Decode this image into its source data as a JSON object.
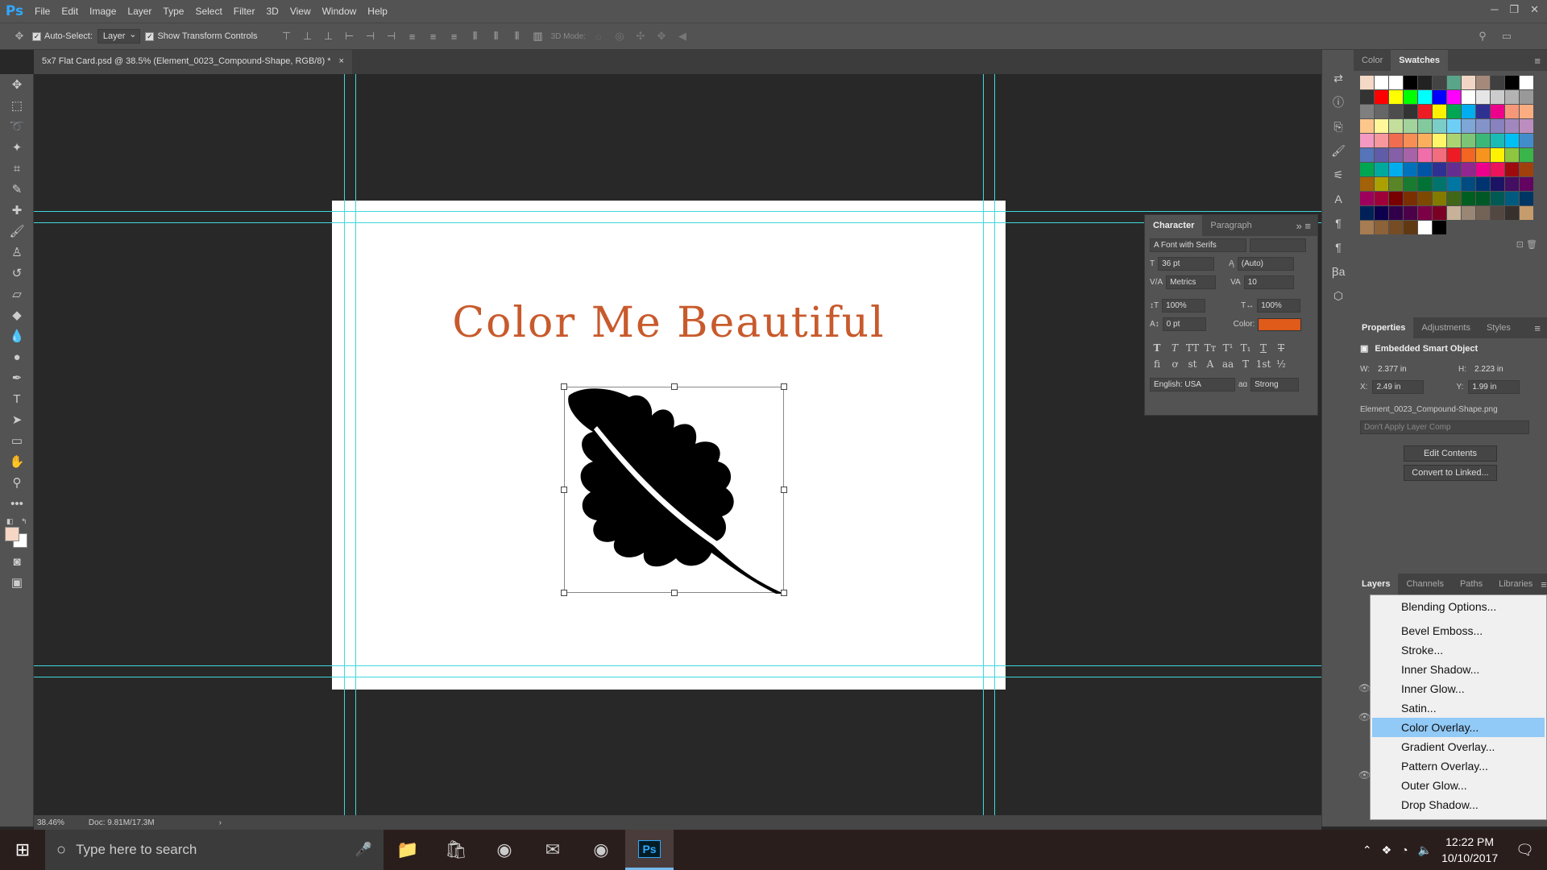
{
  "app": {
    "logo": "Ps"
  },
  "menubar": [
    "File",
    "Edit",
    "Image",
    "Layer",
    "Type",
    "Select",
    "Filter",
    "3D",
    "View",
    "Window",
    "Help"
  ],
  "options": {
    "auto_select_label": "Auto-Select:",
    "auto_select_value": "Layer",
    "show_transform_label": "Show Transform Controls",
    "mode3d_label": "3D Mode:"
  },
  "document": {
    "tab_title": "5x7 Flat Card.psd @ 38.5% (Element_0023_Compound-Shape, RGB/8) *",
    "close_glyph": "×"
  },
  "card": {
    "title": "Color Me Beautiful",
    "title_color": "#c85a2c"
  },
  "status": {
    "zoom": "38.46%",
    "doc": "Doc: 9.81M/17.3M",
    "arrow": "›"
  },
  "color_panel": {
    "tabs": [
      "Color",
      "Swatches"
    ],
    "active": "Swatches"
  },
  "swatch_colors": [
    "#f4d9c7",
    "#fff",
    "#fff",
    "#000",
    "#222",
    "#444",
    "#59a58a",
    "#f2d6c5",
    "#a58a7c",
    "#3f3f3f",
    "#000",
    "#fff",
    "#333",
    "#ff0000",
    "#ffff00",
    "#00ff00",
    "#00ffff",
    "#0000ff",
    "#ff00ff",
    "#fff",
    "#e6e6e6",
    "#cccccc",
    "#b3b3b3",
    "#999999",
    "#7f7f7f",
    "#666",
    "#4d4d4d",
    "#333",
    "#ed1c24",
    "#fff200",
    "#00a651",
    "#00aeef",
    "#2e3192",
    "#ec008c",
    "#f7977a",
    "#f9ad81",
    "#fdc68a",
    "#fff79a",
    "#c4df9b",
    "#a3d39c",
    "#82ca9d",
    "#7bcdc8",
    "#6ecff6",
    "#7ea7d8",
    "#8493ca",
    "#8882be",
    "#a187be",
    "#bc8dbf",
    "#f49ac2",
    "#f6989d",
    "#f26c4f",
    "#f68e56",
    "#fbaf5d",
    "#fff568",
    "#acd372",
    "#7cc576",
    "#3bb878",
    "#1abbb4",
    "#00bff3",
    "#438ccb",
    "#5574b9",
    "#605ca8",
    "#855fa8",
    "#a763a8",
    "#f06eaa",
    "#f26d7d",
    "#ed1c24",
    "#f26522",
    "#f7941d",
    "#fff200",
    "#8dc63f",
    "#39b54a",
    "#00a651",
    "#00a99d",
    "#00aeef",
    "#0072bc",
    "#0054a6",
    "#2e3192",
    "#662d91",
    "#92278f",
    "#ec008c",
    "#ed145b",
    "#9e0b0f",
    "#a0410d",
    "#a36209",
    "#aba000",
    "#598527",
    "#197b30",
    "#007236",
    "#00746b",
    "#0076a3",
    "#004b80",
    "#003471",
    "#1b1464",
    "#440e62",
    "#630460",
    "#9e005d",
    "#9e0039",
    "#790000",
    "#7b2e00",
    "#7d4900",
    "#827b00",
    "#406618",
    "#005e20",
    "#005826",
    "#005952",
    "#005b7f",
    "#003663",
    "#002157",
    "#0d004c",
    "#32004b",
    "#4b0049",
    "#7b0046",
    "#7a0026",
    "#c7b299",
    "#998675",
    "#736357",
    "#534741",
    "#37302d",
    "#c69c6d",
    "#a67c52",
    "#8c6239",
    "#754c24",
    "#603913",
    "#ffffff",
    "#000000"
  ],
  "character": {
    "tabs": [
      "Character",
      "Paragraph"
    ],
    "font_family": "A Font with Serifs",
    "size": "36 pt",
    "leading": "(Auto)",
    "kerning": "Metrics",
    "tracking": "10",
    "vscale": "100%",
    "hscale": "100%",
    "baseline": "0 pt",
    "color_label": "Color:",
    "color": "#e05a1a",
    "language": "English: USA",
    "aa_label": "aɑ",
    "aa": "Strong"
  },
  "properties": {
    "tabs": [
      "Properties",
      "Adjustments",
      "Styles"
    ],
    "kind": "Embedded Smart Object",
    "w_label": "W:",
    "w": "2.377 in",
    "h_label": "H:",
    "h": "2.223 in",
    "x_label": "X:",
    "x": "2.49 in",
    "y_label": "Y:",
    "y": "1.99 in",
    "file": "Element_0023_Compound-Shape.png",
    "layer_comp": "Don't Apply Layer Comp",
    "edit_btn": "Edit Contents",
    "convert_btn": "Convert to Linked..."
  },
  "layers": {
    "tabs": [
      "Layers",
      "Channels",
      "Paths",
      "Libraries"
    ]
  },
  "context_menu": [
    "Blending Options...",
    "Bevel  Emboss...",
    "Stroke...",
    "Inner Shadow...",
    "Inner Glow...",
    "Satin...",
    "Color Overlay...",
    "Gradient Overlay...",
    "Pattern Overlay...",
    "Outer Glow...",
    "Drop Shadow..."
  ],
  "context_highlight": "Color Overlay...",
  "taskbar": {
    "search_placeholder": "Type here to search",
    "time": "12:22 PM",
    "date": "10/10/2017"
  }
}
